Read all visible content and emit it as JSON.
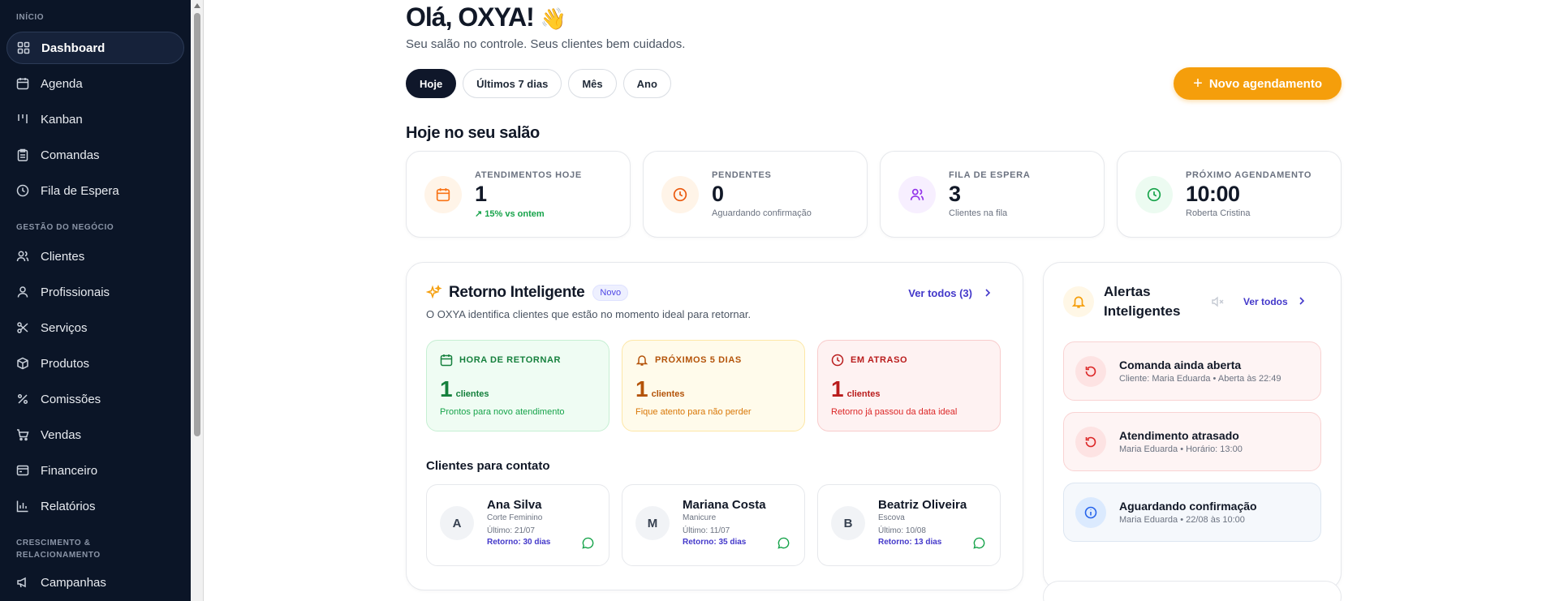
{
  "sidebar": {
    "sections": [
      {
        "label": "INÍCIO",
        "items": [
          {
            "label": "Dashboard",
            "icon": "grid-icon",
            "active": true
          },
          {
            "label": "Agenda",
            "icon": "calendar-icon"
          },
          {
            "label": "Kanban",
            "icon": "kanban-icon"
          },
          {
            "label": "Comandas",
            "icon": "clipboard-icon"
          },
          {
            "label": "Fila de Espera",
            "icon": "clock-icon"
          }
        ]
      },
      {
        "label": "GESTÃO DO NEGÓCIO",
        "items": [
          {
            "label": "Clientes",
            "icon": "users-icon"
          },
          {
            "label": "Profissionais",
            "icon": "user-icon"
          },
          {
            "label": "Serviços",
            "icon": "scissors-icon"
          },
          {
            "label": "Produtos",
            "icon": "box-icon"
          },
          {
            "label": "Comissões",
            "icon": "percent-icon"
          },
          {
            "label": "Vendas",
            "icon": "cart-icon"
          },
          {
            "label": "Financeiro",
            "icon": "wallet-icon"
          },
          {
            "label": "Relatórios",
            "icon": "bar-chart-icon"
          }
        ]
      },
      {
        "label": "CRESCIMENTO & RELACIONAMENTO",
        "items": [
          {
            "label": "Campanhas",
            "icon": "megaphone-icon"
          }
        ]
      }
    ]
  },
  "header": {
    "greeting": "Olá, OXYA!",
    "wave": "👋",
    "subtitle": "Seu salão no controle. Seus clientes bem cuidados."
  },
  "filters": [
    "Hoje",
    "Últimos 7 dias",
    "Mês",
    "Ano"
  ],
  "new_button": "Novo agendamento",
  "today_title": "Hoje no seu salão",
  "stats": [
    {
      "label": "ATENDIMENTOS HOJE",
      "value": "1",
      "sub": "15% vs ontem",
      "trend": "up",
      "color": "#f97316",
      "bg": "#fff4e8",
      "icon": "calendar-icon"
    },
    {
      "label": "PENDENTES",
      "value": "0",
      "sub": "Aguardando confirmação",
      "color": "#ea580c",
      "bg": "#fff4e8",
      "icon": "clock-icon"
    },
    {
      "label": "FILA DE ESPERA",
      "value": "3",
      "sub": "Clientes na fila",
      "color": "#9333ea",
      "bg": "#f7efff",
      "icon": "users-icon"
    },
    {
      "label": "PRÓXIMO AGENDAMENTO",
      "value": "10:00",
      "sub": "Roberta Cristina",
      "color": "#16a34a",
      "bg": "#ecfbf1",
      "icon": "clock-icon"
    }
  ],
  "retorno": {
    "title": "Retorno Inteligente",
    "badge": "Novo",
    "ver_todos": "Ver todos (3)",
    "description": "O OXYA identifica clientes que estão no momento ideal para retornar.",
    "cards": [
      {
        "label": "HORA DE RETORNAR",
        "value": "1",
        "unit": "clientes",
        "note": "Prontos para novo atendimento",
        "tone": "green"
      },
      {
        "label": "PRÓXIMOS 5 DIAS",
        "value": "1",
        "unit": "clientes",
        "note": "Fique atento para não perder",
        "tone": "yellow"
      },
      {
        "label": "EM ATRASO",
        "value": "1",
        "unit": "clientes",
        "note": "Retorno já passou da data ideal",
        "tone": "red"
      }
    ],
    "contacts_title": "Clientes para contato",
    "contacts": [
      {
        "initial": "A",
        "name": "Ana Silva",
        "service": "Corte Feminino",
        "last": "Último: 21/07",
        "return": "Retorno: 30 dias"
      },
      {
        "initial": "M",
        "name": "Mariana Costa",
        "service": "Manicure",
        "last": "Último: 11/07",
        "return": "Retorno: 35 dias"
      },
      {
        "initial": "B",
        "name": "Beatriz Oliveira",
        "service": "Escova",
        "last": "Último: 10/08",
        "return": "Retorno: 13 dias"
      }
    ]
  },
  "alerts": {
    "title": "Alertas Inteligentes",
    "ver_todos": "Ver todos",
    "items": [
      {
        "title": "Comanda ainda aberta",
        "sub": "Cliente: Maria Eduarda • Aberta às 22:49",
        "tone": "red",
        "icon": "refresh-icon"
      },
      {
        "title": "Atendimento atrasado",
        "sub": "Maria Eduarda • Horário: 13:00",
        "tone": "red",
        "icon": "refresh-icon"
      },
      {
        "title": "Aguardando confirmação",
        "sub": "Maria Eduarda • 22/08 às 10:00",
        "tone": "blue",
        "icon": "info-icon"
      }
    ]
  },
  "colors": {
    "sidebar_bg": "#0b1527",
    "accent": "#f59e0b",
    "link": "#4338ca"
  }
}
